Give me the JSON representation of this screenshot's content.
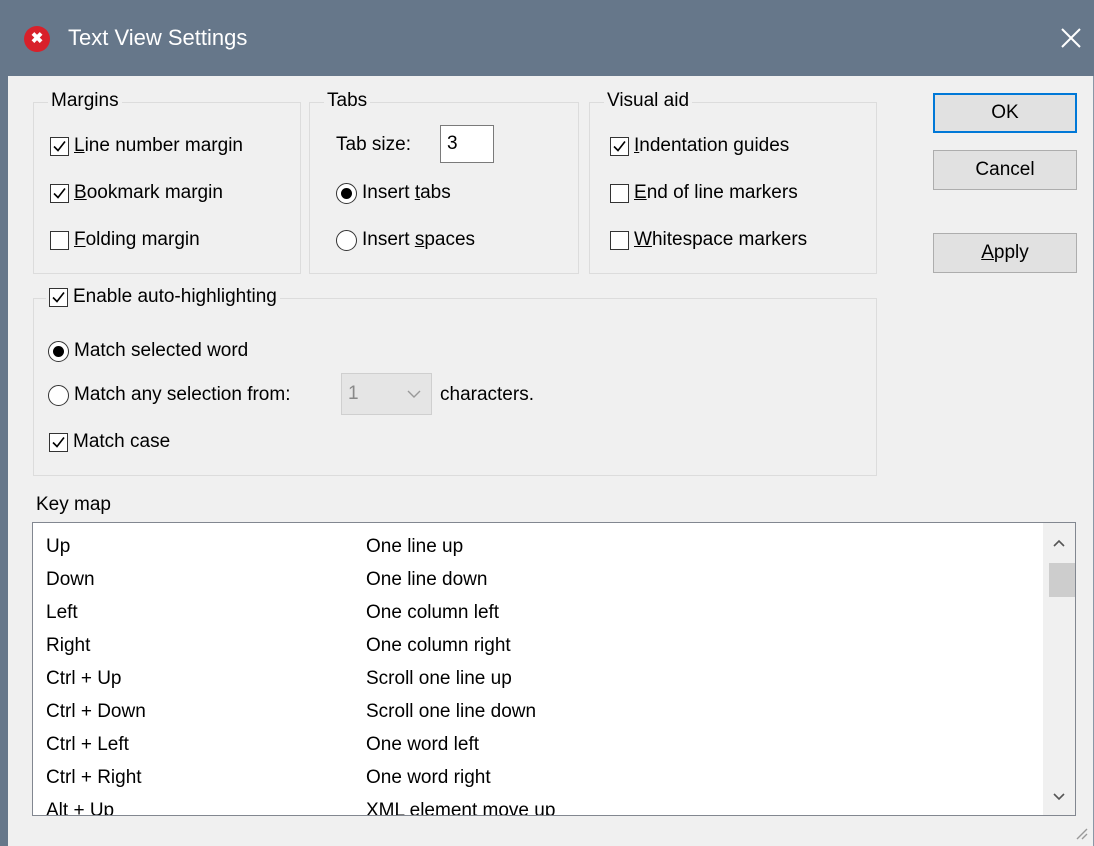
{
  "window": {
    "title": "Text View Settings",
    "app_icon": "altova-x-icon"
  },
  "margins": {
    "label": "Margins",
    "items": [
      {
        "label": "Line number margin",
        "mnemonic": "L",
        "rest": "ine number margin",
        "checked": true
      },
      {
        "label": "Bookmark margin",
        "mnemonic": "B",
        "rest": "ookmark margin",
        "checked": true
      },
      {
        "label": "Folding margin",
        "mnemonic": "F",
        "rest": "olding margin",
        "checked": false
      }
    ]
  },
  "tabs": {
    "label": "Tabs",
    "tab_size_label": "Tab size:",
    "tab_size_value": "3",
    "insert_tabs": {
      "label": "Insert tabs",
      "pre": "Insert ",
      "mnemonic": "t",
      "rest": "abs",
      "selected": true
    },
    "insert_spaces": {
      "label": "Insert spaces",
      "pre": "Insert ",
      "mnemonic": "s",
      "rest": "paces",
      "selected": false
    }
  },
  "visual_aid": {
    "label": "Visual aid",
    "items": [
      {
        "label": "Indentation guides",
        "mnemonic": "I",
        "rest": "ndentation guides",
        "checked": true
      },
      {
        "label": "End of line markers",
        "mnemonic": "E",
        "rest": "nd of line markers",
        "checked": false
      },
      {
        "label": "Whitespace markers",
        "mnemonic": "W",
        "rest": "hitespace markers",
        "checked": false
      }
    ]
  },
  "buttons": {
    "ok": "OK",
    "cancel": "Cancel",
    "apply_mnemonic": "A",
    "apply_rest": "pply",
    "apply": "Apply"
  },
  "auto_highlight": {
    "label": "Enable auto-highlighting",
    "checked": true,
    "match_selected_word": "Match selected word",
    "match_any_selection": "Match any selection from:",
    "chars_value": "1",
    "chars_suffix": "characters.",
    "match_case": "Match case",
    "match_case_checked": true
  },
  "key_map": {
    "label": "Key map",
    "rows": [
      {
        "key": "Up",
        "action": "One line up"
      },
      {
        "key": "Down",
        "action": "One line down"
      },
      {
        "key": "Left",
        "action": "One column left"
      },
      {
        "key": "Right",
        "action": "One column right"
      },
      {
        "key": "Ctrl + Up",
        "action": "Scroll one line up"
      },
      {
        "key": "Ctrl + Down",
        "action": "Scroll one line down"
      },
      {
        "key": "Ctrl + Left",
        "action": "One word left"
      },
      {
        "key": "Ctrl + Right",
        "action": "One word right"
      },
      {
        "key": "Alt + Up",
        "action": "XML element move up"
      }
    ]
  }
}
